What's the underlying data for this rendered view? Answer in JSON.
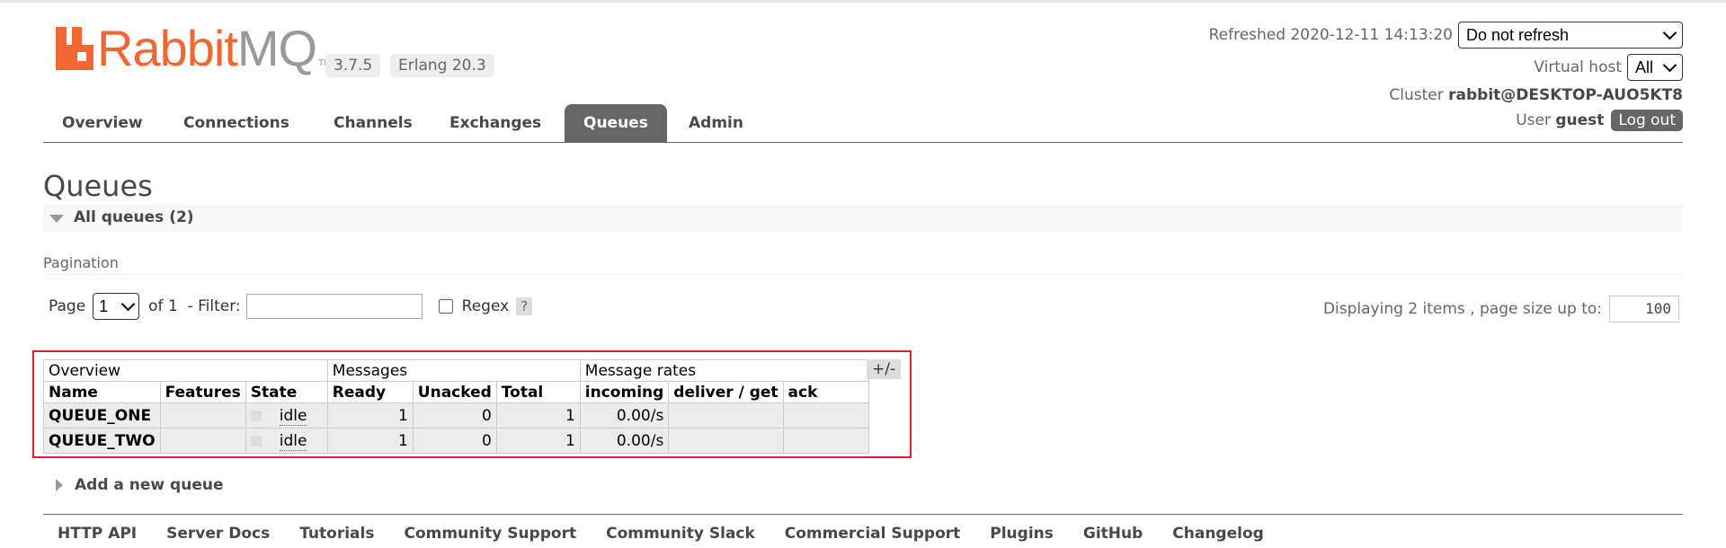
{
  "header": {
    "logo_rabbit": "Rabbit",
    "logo_mq": "MQ",
    "logo_tm": "TM",
    "version": "3.7.5",
    "erlang": "Erlang 20.3",
    "refreshed_label": "Refreshed 2020-12-11 14:13:20",
    "refresh_option": "Do not refresh",
    "vhost_label": "Virtual host",
    "vhost_value": "All",
    "cluster_label": "Cluster",
    "cluster_value": "rabbit@DESKTOP-AUO5KT8",
    "user_label": "User",
    "user_value": "guest",
    "logout_label": "Log out"
  },
  "nav": {
    "tabs": [
      "Overview",
      "Connections",
      "Channels",
      "Exchanges",
      "Queues",
      "Admin"
    ],
    "active": "Queues"
  },
  "page": {
    "title": "Queues",
    "section_label": "All queues (2)",
    "pagination_label": "Pagination",
    "page_label": "Page",
    "page_value": "1",
    "of_label": "of 1",
    "filter_label": "- Filter:",
    "filter_value": "",
    "regex_label": "Regex",
    "help_label": "?",
    "display_label": "Displaying 2 items , page size up to:",
    "page_size": "100"
  },
  "table": {
    "group_headers": [
      "Overview",
      "Messages",
      "Message rates"
    ],
    "columns": [
      "Name",
      "Features",
      "State",
      "Ready",
      "Unacked",
      "Total",
      "incoming",
      "deliver / get",
      "ack"
    ],
    "toggle_label": "+/-",
    "rows": [
      {
        "name": "QUEUE_ONE",
        "features": "",
        "state": "idle",
        "ready": "1",
        "unacked": "0",
        "total": "1",
        "incoming": "0.00/s",
        "deliver_get": "",
        "ack": ""
      },
      {
        "name": "QUEUE_TWO",
        "features": "",
        "state": "idle",
        "ready": "1",
        "unacked": "0",
        "total": "1",
        "incoming": "0.00/s",
        "deliver_get": "",
        "ack": ""
      }
    ]
  },
  "add_queue_label": "Add a new queue",
  "footer": {
    "links": [
      "HTTP API",
      "Server Docs",
      "Tutorials",
      "Community Support",
      "Community Slack",
      "Commercial Support",
      "Plugins",
      "GitHub",
      "Changelog"
    ]
  },
  "colors": {
    "brand_orange": "#f26631",
    "active_tab": "#666666",
    "highlight_border": "#e0202a"
  }
}
